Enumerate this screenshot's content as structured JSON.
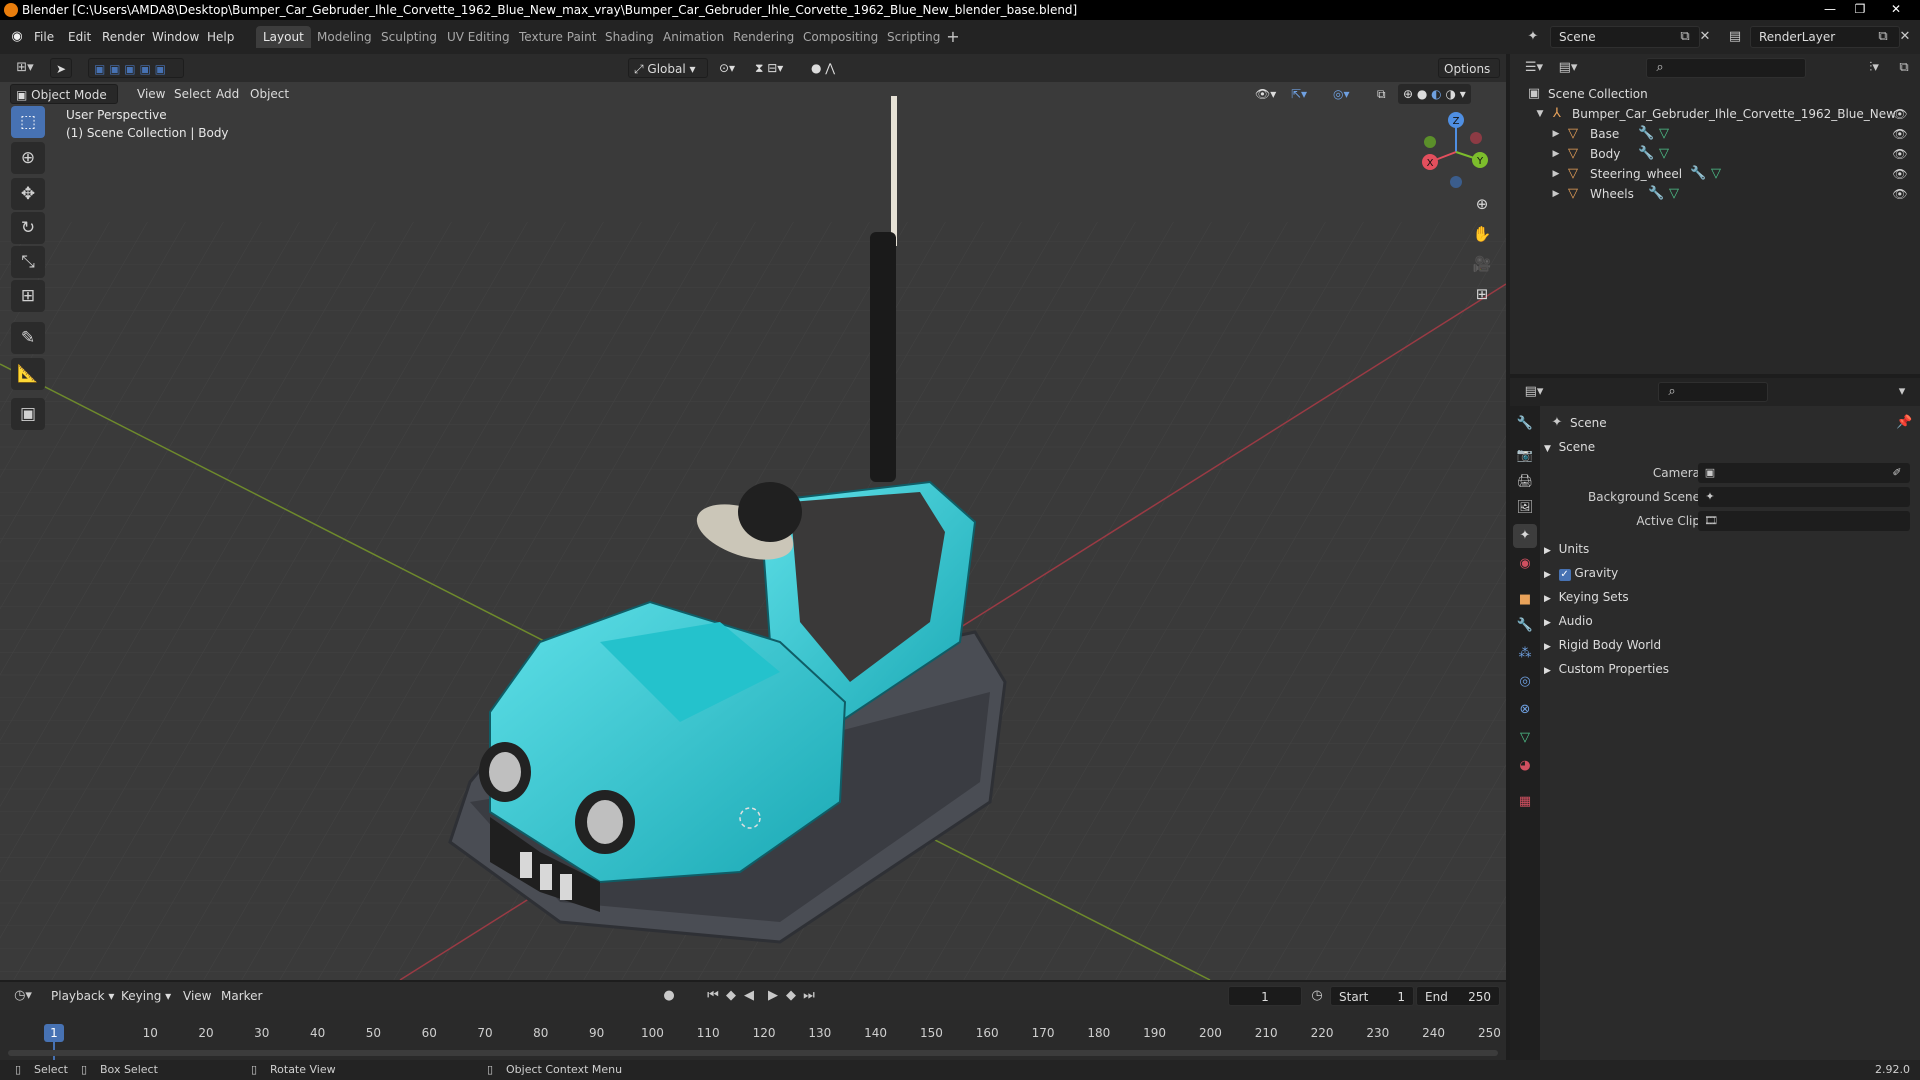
{
  "window": {
    "title": "Blender [C:\\Users\\AMDA8\\Desktop\\Bumper_Car_Gebruder_Ihle_Corvette_1962_Blue_New_max_vray\\Bumper_Car_Gebruder_Ihle_Corvette_1962_Blue_New_blender_base.blend]",
    "min": "—",
    "max": "❐",
    "close": "✕"
  },
  "menu": {
    "file": "File",
    "edit": "Edit",
    "render": "Render",
    "window": "Window",
    "help": "Help"
  },
  "workspaces": [
    "Layout",
    "Modeling",
    "Sculpting",
    "UV Editing",
    "Texture Paint",
    "Shading",
    "Animation",
    "Rendering",
    "Compositing",
    "Scripting"
  ],
  "scene_selector": {
    "value": "Scene"
  },
  "view_layer": {
    "value": "RenderLayer"
  },
  "toolheader": {
    "orientation": "Global",
    "options": "Options"
  },
  "viewport_header": {
    "mode": "Object Mode",
    "view": "View",
    "select": "Select",
    "add": "Add",
    "object": "Object"
  },
  "viewport": {
    "perspective": "User Perspective",
    "context": "(1) Scene Collection | Body"
  },
  "gizmo": {
    "x": "X",
    "y": "Y",
    "z": "Z"
  },
  "outliner": {
    "root": "Scene Collection",
    "collection": "Bumper_Car_Gebruder_Ihle_Corvette_1962_Blue_New",
    "objects": [
      "Base",
      "Body",
      "Steering_wheel",
      "Wheels"
    ]
  },
  "properties": {
    "header": "Scene",
    "panel": "Scene",
    "camera_label": "Camera",
    "background_scene_label": "Background Scene",
    "active_clip_label": "Active Clip",
    "subpanels": [
      "Units",
      "Gravity",
      "Keying Sets",
      "Audio",
      "Rigid Body World",
      "Custom Properties"
    ],
    "gravity_enabled": true
  },
  "timeline": {
    "playback": "Playback",
    "keying": "Keying",
    "view": "View",
    "marker": "Marker",
    "current_frame": "1",
    "start_label": "Start",
    "start": "1",
    "end_label": "End",
    "end": "250",
    "ticks": [
      "1",
      "10",
      "20",
      "30",
      "40",
      "50",
      "60",
      "70",
      "80",
      "90",
      "100",
      "110",
      "120",
      "130",
      "140",
      "150",
      "160",
      "170",
      "180",
      "190",
      "200",
      "210",
      "220",
      "230",
      "240",
      "250"
    ]
  },
  "status": {
    "select": "Select",
    "box_select": "Box Select",
    "rotate": "Rotate View",
    "context_menu": "Object Context Menu",
    "version": "2.92.0"
  }
}
